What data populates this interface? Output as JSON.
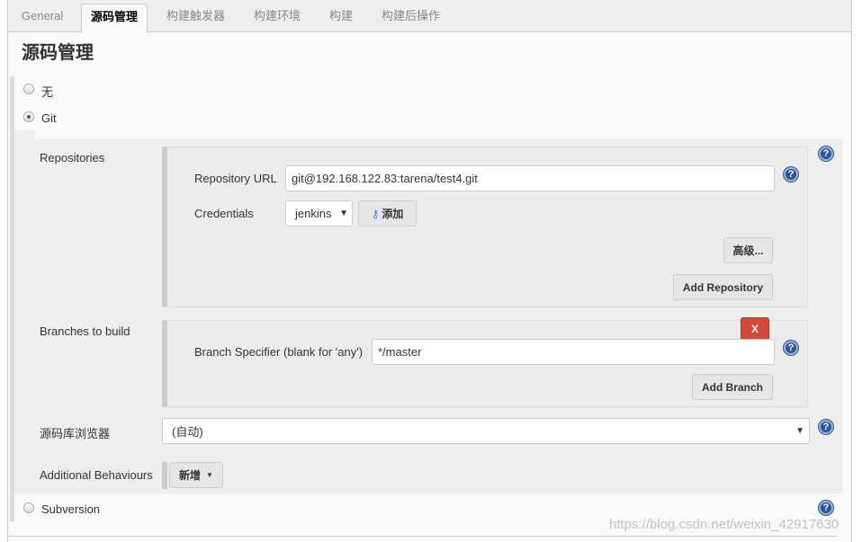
{
  "tabs": [
    {
      "label": "General"
    },
    {
      "label": "源码管理"
    },
    {
      "label": "构建触发器"
    },
    {
      "label": "构建环境"
    },
    {
      "label": "构建"
    },
    {
      "label": "构建后操作"
    }
  ],
  "section_title": "源码管理",
  "scm_options": {
    "none": "无",
    "git": "Git",
    "svn": "Subversion",
    "selected": "Git"
  },
  "repositories": {
    "label": "Repositories",
    "url_label": "Repository URL",
    "url_value": "git@192.168.122.83:tarena/test4.git",
    "credentials_label": "Credentials",
    "credentials_value": "jenkins",
    "add_label": "添加",
    "advanced_label": "高级...",
    "add_repo_label": "Add Repository"
  },
  "branches": {
    "label": "Branches to build",
    "delete_label": "X",
    "specifier_label": "Branch Specifier (blank for 'any')",
    "specifier_value": "*/master",
    "add_branch_label": "Add Branch"
  },
  "browser": {
    "label": "源码库浏览器",
    "value": "(自动)"
  },
  "behaviours": {
    "label": "Additional Behaviours",
    "add_label": "新增"
  },
  "help_glyph": "?",
  "watermark": "https://blog.csdn.net/weixin_42917630"
}
